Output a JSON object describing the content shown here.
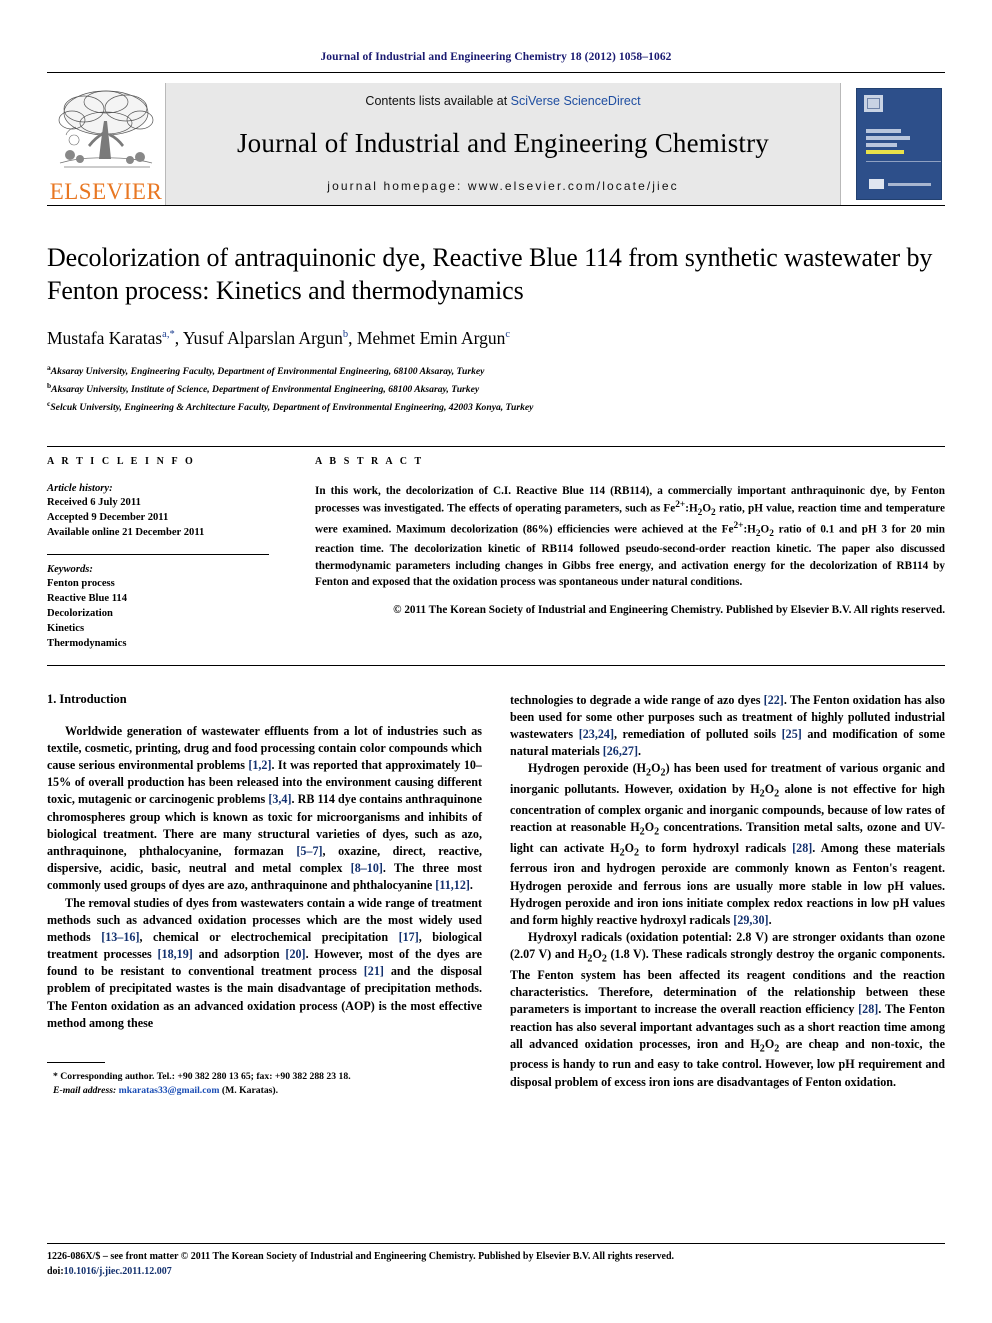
{
  "running_head": "Journal of Industrial and Engineering Chemistry 18 (2012) 1058–1062",
  "masthead": {
    "publisher_name": "ELSEVIER",
    "contents_prefix": "Contents lists available at ",
    "contents_link": "SciVerse ScienceDirect",
    "journal_title": "Journal of Industrial and Engineering Chemistry",
    "homepage": "journal homepage: www.elsevier.com/locate/jiec",
    "cover_caption": "Journal of Industrial and Engineering Chemistry"
  },
  "article": {
    "title": "Decolorization of antraquinonic dye, Reactive Blue 114 from synthetic wastewater by Fenton process: Kinetics and thermodynamics",
    "authors": [
      {
        "name": "Mustafa Karatas",
        "sup": "a,*"
      },
      {
        "name": "Yusuf Alparslan Argun",
        "sup": "b"
      },
      {
        "name": "Mehmet Emin Argun",
        "sup": "c"
      }
    ],
    "affiliations": [
      {
        "sup": "a",
        "text": "Aksaray University, Engineering Faculty, Department of Environmental Engineering, 68100 Aksaray, Turkey"
      },
      {
        "sup": "b",
        "text": "Aksaray University, Institute of Science, Department of Environmental Engineering, 68100 Aksaray, Turkey"
      },
      {
        "sup": "c",
        "text": "Selcuk University, Engineering & Architecture Faculty, Department of Environmental Engineering, 42003 Konya, Turkey"
      }
    ]
  },
  "article_info": {
    "heading": "A R T I C L E   I N F O",
    "history_label": "Article history:",
    "history": [
      "Received 6 July 2011",
      "Accepted 9 December 2011",
      "Available online 21 December 2011"
    ],
    "keywords_label": "Keywords:",
    "keywords": [
      "Fenton process",
      "Reactive Blue 114",
      "Decolorization",
      "Kinetics",
      "Thermodynamics"
    ]
  },
  "abstract": {
    "heading": "A B S T R A C T",
    "copyright": "© 2011 The Korean Society of Industrial and Engineering Chemistry. Published by Elsevier B.V. All rights reserved."
  },
  "introduction": {
    "heading": "1. Introduction"
  },
  "footnote": {
    "corresponding": "* Corresponding author. Tel.: +90 382 280 13 65; fax: +90 382 288 23 18.",
    "email_label": "E-mail address:",
    "email": "mkaratas33@gmail.com",
    "email_owner": "(M. Karatas)."
  },
  "page_footer": {
    "line1": "1226-086X/$ – see front matter © 2011 The Korean Society of Industrial and Engineering Chemistry. Published by Elsevier B.V. All rights reserved.",
    "doi_label": "doi:",
    "doi": "10.1016/j.jiec.2011.12.007"
  }
}
